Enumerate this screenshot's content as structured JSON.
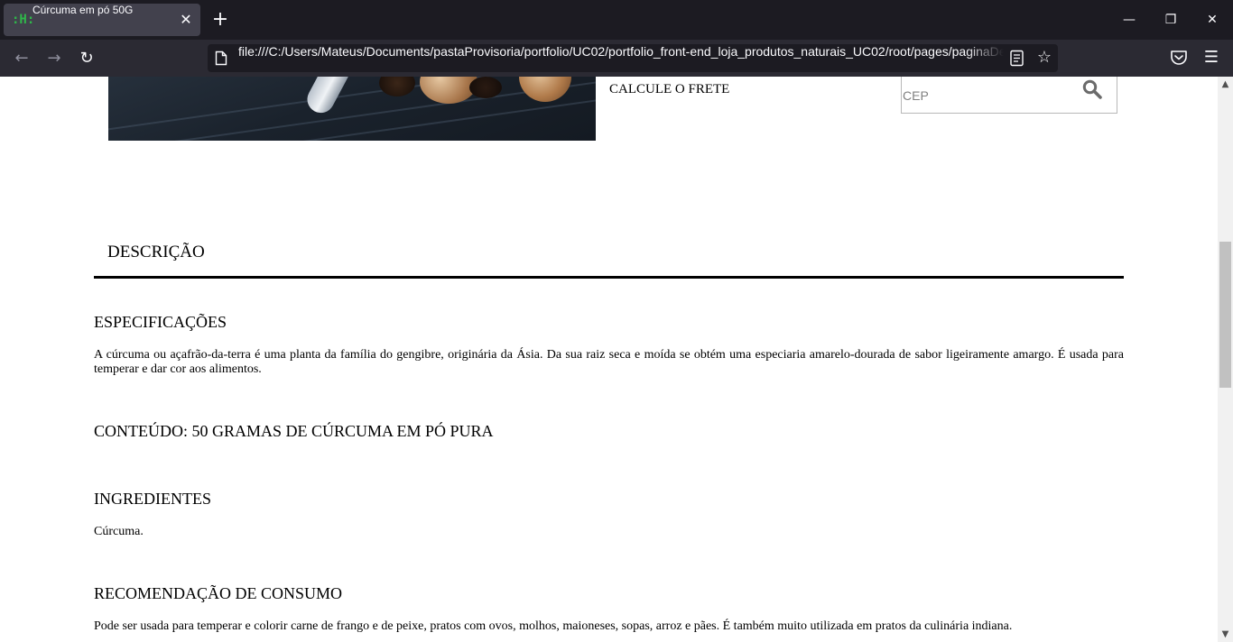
{
  "browser": {
    "tab": {
      "title": "Cúrcuma em pó 50G",
      "favicon_text": ":H:",
      "close_glyph": "✕"
    },
    "new_tab_glyph": "+",
    "window_controls": {
      "minimize": "—",
      "maximize": "❐",
      "close": "✕"
    },
    "nav": {
      "back": "←",
      "forward": "→",
      "reload": "↻",
      "menu": "☰"
    },
    "url": "file:///C:/Users/Mateus/Documents/pastaProvisoria/portfolio/UC02/portfolio_front-end_loja_produtos_naturais_UC02/root/pages/paginaDe",
    "bookmark_glyph": "☆"
  },
  "page": {
    "freight": {
      "label": "CALCULE O FRETE",
      "cep_placeholder": "CEP"
    },
    "description_tab": "DESCRIÇÃO",
    "sections": {
      "specs_title": "ESPECIFICAÇÕES",
      "specs_text": "A cúrcuma ou açafrão-da-terra é uma planta da família do gengibre, originária da Ásia. Da sua raiz seca e moída se obtém uma especiaria amarelo-dourada de sabor ligeiramente amargo. É usada para temperar e dar cor aos alimentos.",
      "content_title": "CONTEÚDO: 50 GRAMAS DE CÚRCUMA EM PÓ PURA",
      "ingredients_title": "INGREDIENTES",
      "ingredients_text": "Cúrcuma.",
      "recommendation_title": "RECOMENDAÇÃO DE CONSUMO",
      "recommendation_text": "Pode ser usada para temperar e colorir carne de frango e de peixe, pratos com ovos, molhos, maioneses, sopas, arroz e pães. É também muito utilizada em pratos da culinária indiana."
    }
  },
  "scrollbar": {
    "up": "▲",
    "down": "▼"
  },
  "colors": {
    "tabbar_bg": "#1c1b22",
    "toolbar_bg": "#2b2a33",
    "active_tab_bg": "#42414d",
    "favicon_green": "#2fb84a"
  }
}
